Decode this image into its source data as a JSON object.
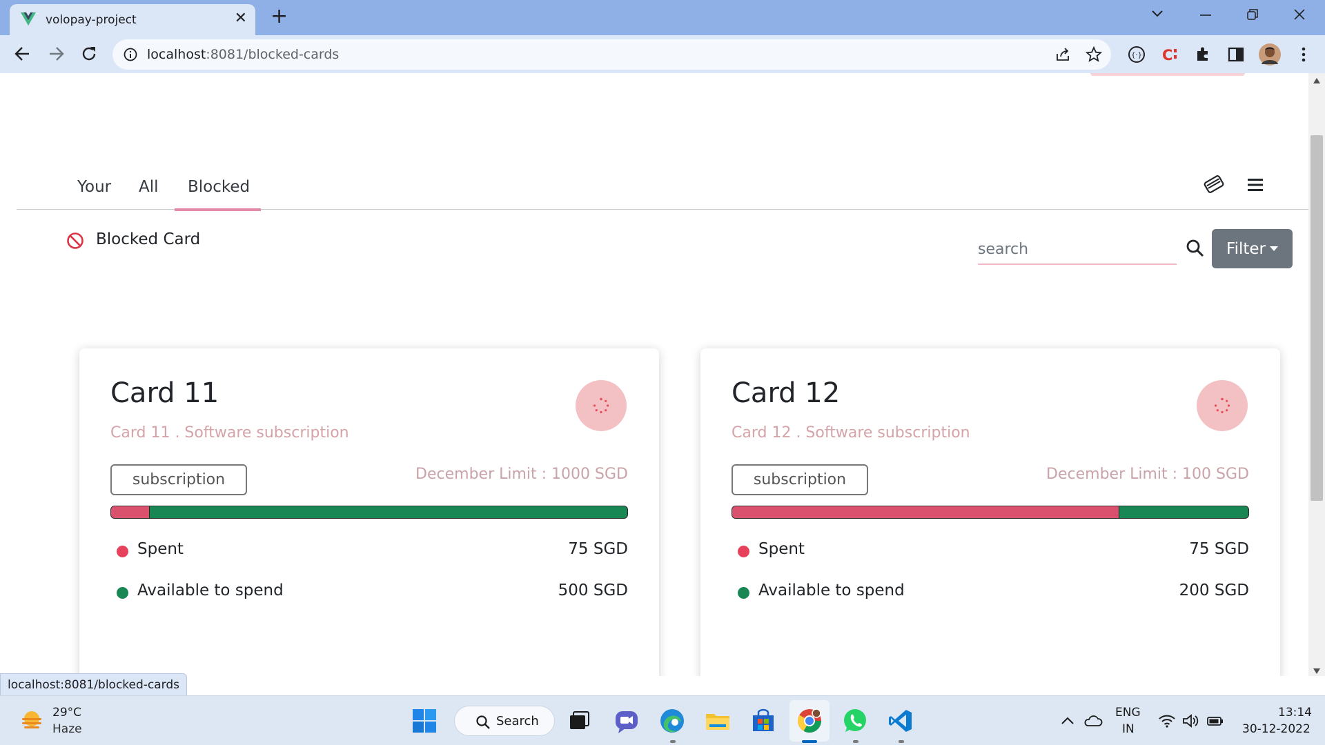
{
  "browser": {
    "tab_title": "volopay-project",
    "url_host": "localhost",
    "url_path": ":8081/blocked-cards",
    "status_url": "localhost:8081/blocked-cards"
  },
  "page": {
    "tabs": [
      "Your",
      "All",
      "Blocked"
    ],
    "active_tab": "Blocked",
    "section_label": "Blocked Card",
    "search_placeholder": "search",
    "filter_label": "Filter",
    "cards": [
      {
        "title": "Card 11",
        "subtitle": "Card 11 . Software subscription",
        "tag": "subscription",
        "limit": "December Limit : 1000 SGD",
        "spent_label": "Spent",
        "spent_value": "75 SGD",
        "available_label": "Available to spend",
        "available_value": "500 SGD",
        "spent_fraction": 0.075
      },
      {
        "title": "Card 12",
        "subtitle": "Card 12 . Software subscription",
        "tag": "subscription",
        "limit": "December Limit : 100 SGD",
        "spent_label": "Spent",
        "spent_value": "75 SGD",
        "available_label": "Available to spend",
        "available_value": "200 SGD",
        "spent_fraction": 0.75
      }
    ]
  },
  "colors": {
    "spent": "#d9516d",
    "available": "#198754",
    "spent_dot": "#e8415c",
    "available_dot": "#198754",
    "accent_underline": "#e38aa6"
  },
  "taskbar": {
    "weather_temp": "29°C",
    "weather_desc": "Haze",
    "search_label": "Search",
    "lang_top": "ENG",
    "lang_bottom": "IN",
    "time": "13:14",
    "date": "30-12-2022"
  }
}
